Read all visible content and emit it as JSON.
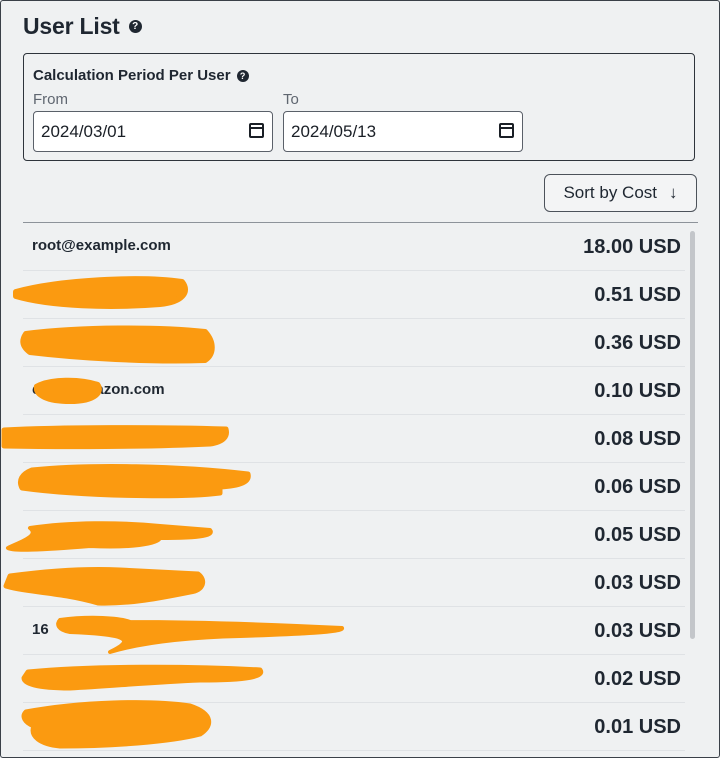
{
  "header": {
    "title": "User List"
  },
  "period": {
    "title": "Calculation Period Per User",
    "from_label": "From",
    "to_label": "To",
    "from_value": "2024/03/01",
    "to_value": "2024/05/13"
  },
  "sort": {
    "label": "Sort by Cost",
    "arrow": "↓"
  },
  "users": [
    {
      "email": "root@example.com",
      "cost": "18.00 USD"
    },
    {
      "email": "",
      "cost": "0.51 USD"
    },
    {
      "email": "",
      "cost": "0.36 USD"
    },
    {
      "email": "e          mazon.com",
      "cost": "0.10 USD"
    },
    {
      "email": "",
      "cost": "0.08 USD"
    },
    {
      "email": "",
      "cost": "0.06 USD"
    },
    {
      "email": "",
      "cost": "0.05 USD"
    },
    {
      "email": "",
      "cost": "0.03 USD"
    },
    {
      "email": "16",
      "cost": "0.03 USD"
    },
    {
      "email": "",
      "cost": "0.02 USD"
    },
    {
      "email": "",
      "cost": "0.01 USD"
    }
  ],
  "colors": {
    "redaction": "#fb9a10",
    "text": "#1f2731",
    "background": "#eff1f2"
  }
}
